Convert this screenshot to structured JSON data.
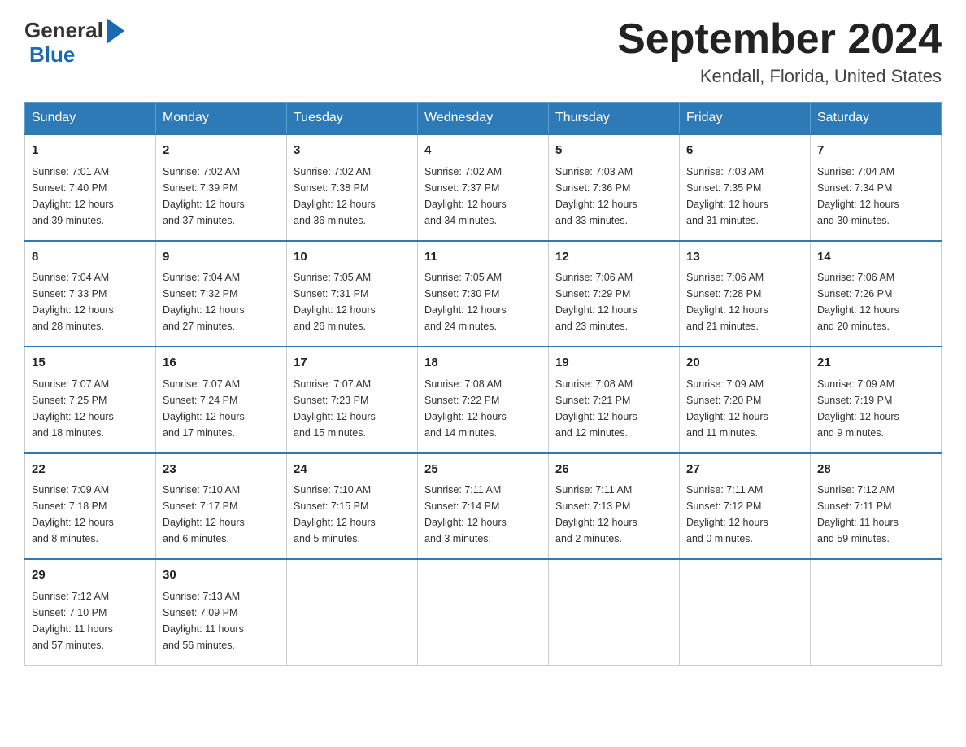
{
  "logo": {
    "text_general": "General",
    "text_blue": "Blue"
  },
  "title": "September 2024",
  "subtitle": "Kendall, Florida, United States",
  "days_header": [
    "Sunday",
    "Monday",
    "Tuesday",
    "Wednesday",
    "Thursday",
    "Friday",
    "Saturday"
  ],
  "weeks": [
    [
      {
        "day": "1",
        "info": "Sunrise: 7:01 AM\nSunset: 7:40 PM\nDaylight: 12 hours\nand 39 minutes."
      },
      {
        "day": "2",
        "info": "Sunrise: 7:02 AM\nSunset: 7:39 PM\nDaylight: 12 hours\nand 37 minutes."
      },
      {
        "day": "3",
        "info": "Sunrise: 7:02 AM\nSunset: 7:38 PM\nDaylight: 12 hours\nand 36 minutes."
      },
      {
        "day": "4",
        "info": "Sunrise: 7:02 AM\nSunset: 7:37 PM\nDaylight: 12 hours\nand 34 minutes."
      },
      {
        "day": "5",
        "info": "Sunrise: 7:03 AM\nSunset: 7:36 PM\nDaylight: 12 hours\nand 33 minutes."
      },
      {
        "day": "6",
        "info": "Sunrise: 7:03 AM\nSunset: 7:35 PM\nDaylight: 12 hours\nand 31 minutes."
      },
      {
        "day": "7",
        "info": "Sunrise: 7:04 AM\nSunset: 7:34 PM\nDaylight: 12 hours\nand 30 minutes."
      }
    ],
    [
      {
        "day": "8",
        "info": "Sunrise: 7:04 AM\nSunset: 7:33 PM\nDaylight: 12 hours\nand 28 minutes."
      },
      {
        "day": "9",
        "info": "Sunrise: 7:04 AM\nSunset: 7:32 PM\nDaylight: 12 hours\nand 27 minutes."
      },
      {
        "day": "10",
        "info": "Sunrise: 7:05 AM\nSunset: 7:31 PM\nDaylight: 12 hours\nand 26 minutes."
      },
      {
        "day": "11",
        "info": "Sunrise: 7:05 AM\nSunset: 7:30 PM\nDaylight: 12 hours\nand 24 minutes."
      },
      {
        "day": "12",
        "info": "Sunrise: 7:06 AM\nSunset: 7:29 PM\nDaylight: 12 hours\nand 23 minutes."
      },
      {
        "day": "13",
        "info": "Sunrise: 7:06 AM\nSunset: 7:28 PM\nDaylight: 12 hours\nand 21 minutes."
      },
      {
        "day": "14",
        "info": "Sunrise: 7:06 AM\nSunset: 7:26 PM\nDaylight: 12 hours\nand 20 minutes."
      }
    ],
    [
      {
        "day": "15",
        "info": "Sunrise: 7:07 AM\nSunset: 7:25 PM\nDaylight: 12 hours\nand 18 minutes."
      },
      {
        "day": "16",
        "info": "Sunrise: 7:07 AM\nSunset: 7:24 PM\nDaylight: 12 hours\nand 17 minutes."
      },
      {
        "day": "17",
        "info": "Sunrise: 7:07 AM\nSunset: 7:23 PM\nDaylight: 12 hours\nand 15 minutes."
      },
      {
        "day": "18",
        "info": "Sunrise: 7:08 AM\nSunset: 7:22 PM\nDaylight: 12 hours\nand 14 minutes."
      },
      {
        "day": "19",
        "info": "Sunrise: 7:08 AM\nSunset: 7:21 PM\nDaylight: 12 hours\nand 12 minutes."
      },
      {
        "day": "20",
        "info": "Sunrise: 7:09 AM\nSunset: 7:20 PM\nDaylight: 12 hours\nand 11 minutes."
      },
      {
        "day": "21",
        "info": "Sunrise: 7:09 AM\nSunset: 7:19 PM\nDaylight: 12 hours\nand 9 minutes."
      }
    ],
    [
      {
        "day": "22",
        "info": "Sunrise: 7:09 AM\nSunset: 7:18 PM\nDaylight: 12 hours\nand 8 minutes."
      },
      {
        "day": "23",
        "info": "Sunrise: 7:10 AM\nSunset: 7:17 PM\nDaylight: 12 hours\nand 6 minutes."
      },
      {
        "day": "24",
        "info": "Sunrise: 7:10 AM\nSunset: 7:15 PM\nDaylight: 12 hours\nand 5 minutes."
      },
      {
        "day": "25",
        "info": "Sunrise: 7:11 AM\nSunset: 7:14 PM\nDaylight: 12 hours\nand 3 minutes."
      },
      {
        "day": "26",
        "info": "Sunrise: 7:11 AM\nSunset: 7:13 PM\nDaylight: 12 hours\nand 2 minutes."
      },
      {
        "day": "27",
        "info": "Sunrise: 7:11 AM\nSunset: 7:12 PM\nDaylight: 12 hours\nand 0 minutes."
      },
      {
        "day": "28",
        "info": "Sunrise: 7:12 AM\nSunset: 7:11 PM\nDaylight: 11 hours\nand 59 minutes."
      }
    ],
    [
      {
        "day": "29",
        "info": "Sunrise: 7:12 AM\nSunset: 7:10 PM\nDaylight: 11 hours\nand 57 minutes."
      },
      {
        "day": "30",
        "info": "Sunrise: 7:13 AM\nSunset: 7:09 PM\nDaylight: 11 hours\nand 56 minutes."
      },
      {
        "day": "",
        "info": ""
      },
      {
        "day": "",
        "info": ""
      },
      {
        "day": "",
        "info": ""
      },
      {
        "day": "",
        "info": ""
      },
      {
        "day": "",
        "info": ""
      }
    ]
  ]
}
